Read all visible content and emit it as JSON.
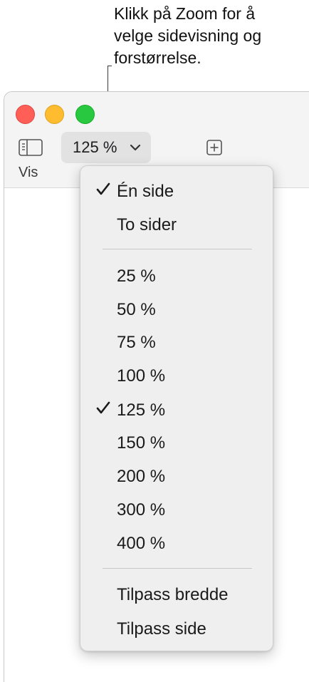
{
  "callout": {
    "text": "Klikk på Zoom for å\nvelge sidevisning og\nforstørrelse."
  },
  "toolbar": {
    "view_label": "Vis",
    "zoom_value": "125 %"
  },
  "menu": {
    "page_items": [
      {
        "label": "Én side",
        "checked": true
      },
      {
        "label": "To sider",
        "checked": false
      }
    ],
    "zoom_items": [
      {
        "label": "25 %",
        "checked": false
      },
      {
        "label": "50 %",
        "checked": false
      },
      {
        "label": "75 %",
        "checked": false
      },
      {
        "label": "100 %",
        "checked": false
      },
      {
        "label": "125 %",
        "checked": true
      },
      {
        "label": "150 %",
        "checked": false
      },
      {
        "label": "200 %",
        "checked": false
      },
      {
        "label": "300 %",
        "checked": false
      },
      {
        "label": "400 %",
        "checked": false
      }
    ],
    "fit_items": [
      {
        "label": "Tilpass bredde",
        "checked": false
      },
      {
        "label": "Tilpass side",
        "checked": false
      }
    ]
  },
  "icons": {
    "view": "sidebar-icon",
    "zoom_chevron": "chevron-down-icon",
    "add": "add-page-icon",
    "check": "checkmark-icon"
  },
  "colors": {
    "close": "#ff5f57",
    "minimize": "#febc2e",
    "zoom": "#28c840"
  }
}
